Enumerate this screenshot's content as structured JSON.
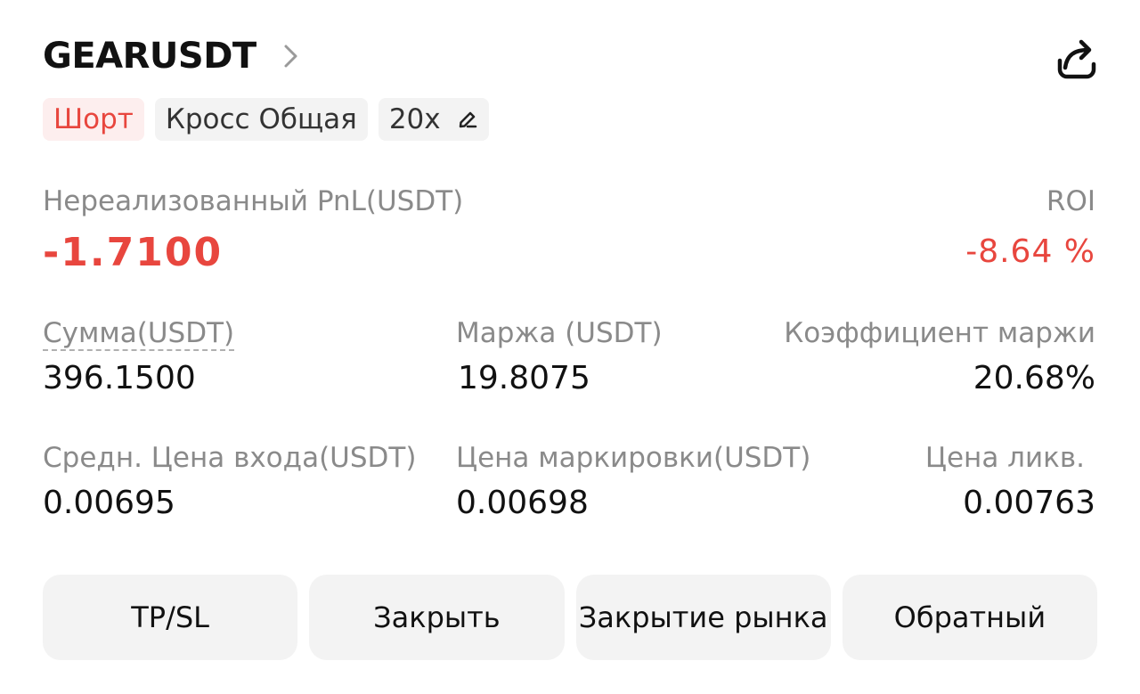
{
  "header": {
    "symbol": "GEARUSDT"
  },
  "tags": {
    "side": "Шорт",
    "mode": "Кросс Общая",
    "leverage": "20x"
  },
  "pnl": {
    "label": "Нереализованный PnL(USDT)",
    "value": "-1.7100"
  },
  "roi": {
    "label": "ROI",
    "value": "-8.64 %"
  },
  "stats": [
    {
      "label": "Сумма(USDT)",
      "value": "396.1500"
    },
    {
      "label": "Маржа (USDT)",
      "value": "19.8075"
    },
    {
      "label": "Коэффициент маржи",
      "value": "20.68%"
    },
    {
      "label": "Средн. Цена входа(USDT)",
      "value": "0.00695"
    },
    {
      "label": "Цена маркировки(USDT)",
      "value": "0.00698"
    },
    {
      "label": "Цена ликв.",
      "value": "0.00763"
    }
  ],
  "buttons": {
    "tpsl": "TP/SL",
    "close": "Закрыть",
    "market_close": "Закрытие рынка",
    "reverse": "Обратный"
  },
  "colors": {
    "negative": "#e8463e",
    "muted": "#8a8a8a",
    "button_bg": "#f3f3f3"
  }
}
